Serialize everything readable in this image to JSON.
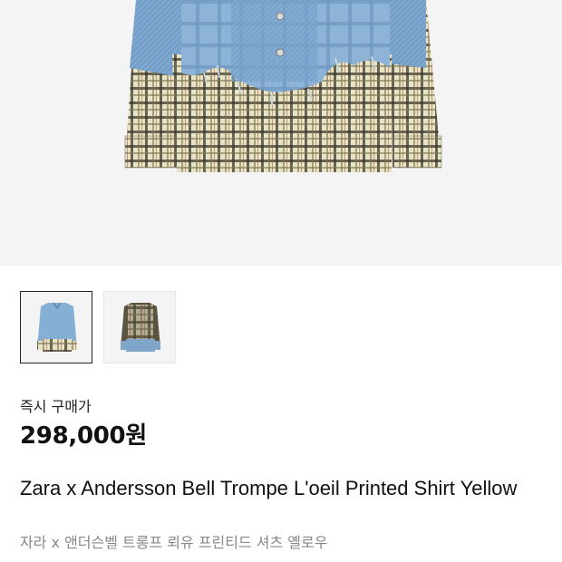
{
  "product": {
    "main_image": "product-shirt-image",
    "thumbnails": [
      {
        "name": "thumbnail-front-denim",
        "selected": true
      },
      {
        "name": "thumbnail-alt-plaid",
        "selected": false
      }
    ],
    "buy_now_label": "즉시 구매가",
    "price": "298,000원",
    "title": "Zara x Andersson Bell Trompe L'oeil Printed Shirt Yellow",
    "subtitle": "자라 x 앤더슨벨 트롱프 뢰유 프린티드 셔츠 옐로우"
  }
}
